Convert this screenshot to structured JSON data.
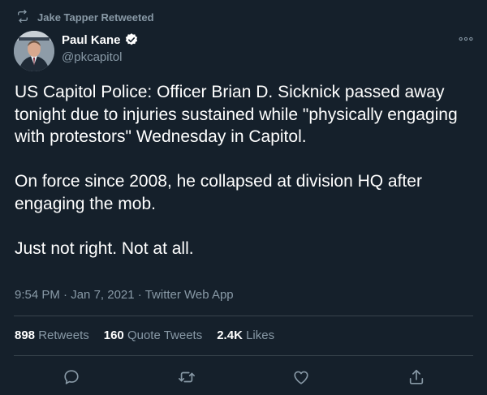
{
  "context": {
    "retweeted_by": "Jake Tapper Retweeted",
    "icon": "retweet-icon"
  },
  "author": {
    "name": "Paul Kane",
    "handle": "@pkcapitol",
    "verified": true
  },
  "tweet": {
    "paragraphs": [
      "US Capitol Police: Officer Brian D. Sicknick passed away tonight due to injuries sustained while \"physically engaging with protestors\" Wednesday in Capitol.",
      "On force since 2008, he collapsed at division HQ after engaging the mob.",
      "Just not right. Not at all."
    ],
    "time": "9:54 PM",
    "date": "Jan 7, 2021",
    "source": "Twitter Web App"
  },
  "stats": {
    "retweets_count": "898",
    "retweets_label": "Retweets",
    "quotes_count": "160",
    "quotes_label": "Quote Tweets",
    "likes_count": "2.4K",
    "likes_label": "Likes"
  },
  "actions": [
    "reply-icon",
    "retweet-icon",
    "like-icon",
    "share-icon"
  ],
  "colors": {
    "background": "#15202b",
    "text": "#ffffff",
    "secondary": "#8899a6",
    "divider": "#38444d"
  }
}
